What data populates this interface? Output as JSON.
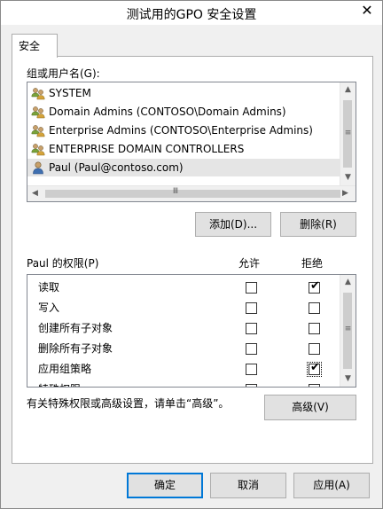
{
  "window": {
    "title": "测试用的GPO 安全设置",
    "close_symbol": "✕"
  },
  "tabs": [
    {
      "label": "安全"
    }
  ],
  "groups": {
    "label": "组或用户名(G):",
    "items": [
      {
        "name": "SYSTEM",
        "icon": "group-icon"
      },
      {
        "name": "Domain Admins (CONTOSO\\Domain Admins)",
        "icon": "group-icon"
      },
      {
        "name": "Enterprise Admins (CONTOSO\\Enterprise Admins)",
        "icon": "group-icon"
      },
      {
        "name": "ENTERPRISE DOMAIN CONTROLLERS",
        "icon": "group-icon"
      },
      {
        "name": "Paul (Paul@contoso.com)",
        "icon": "user-icon",
        "selected": true
      }
    ]
  },
  "buttons": {
    "add": "添加(D)...",
    "remove": "删除(R)",
    "advanced": "高级(V)",
    "ok": "确定",
    "cancel": "取消",
    "apply": "应用(A)"
  },
  "permissions": {
    "label": "Paul 的权限(P)",
    "allow_header": "允许",
    "deny_header": "拒绝",
    "items": [
      {
        "name": "读取",
        "allow": false,
        "deny": true
      },
      {
        "name": "写入",
        "allow": false,
        "deny": false
      },
      {
        "name": "创建所有子对象",
        "allow": false,
        "deny": false
      },
      {
        "name": "删除所有子对象",
        "allow": false,
        "deny": false
      },
      {
        "name": "应用组策略",
        "allow": false,
        "deny": true
      },
      {
        "name": "特殊权限",
        "allow": false,
        "deny": false
      }
    ]
  },
  "advanced_note": "有关特殊权限或高级设置，请单击“高级”。",
  "colors": {
    "selection": "#e5e5e5",
    "border": "#adadad",
    "default_button_border": "#0078d7"
  }
}
